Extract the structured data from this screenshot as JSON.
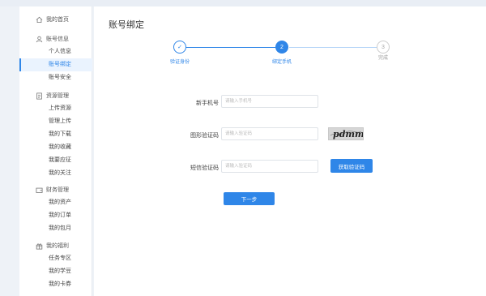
{
  "sidebar": {
    "home": {
      "label": "我的首页",
      "icon": "home-icon"
    },
    "account": {
      "label": "账号信息",
      "icon": "user-icon",
      "items": [
        "个人信息",
        "账号绑定",
        "账号安全"
      ],
      "active_index": 1
    },
    "resources": {
      "label": "资源管理",
      "icon": "document-icon",
      "items": [
        "上传资源",
        "管理上传",
        "我的下载",
        "我的收藏",
        "我要应征",
        "我的关注"
      ]
    },
    "finance": {
      "label": "财务管理",
      "icon": "wallet-icon",
      "items": [
        "我的资产",
        "我的订单",
        "我的包月"
      ]
    },
    "welfare": {
      "label": "我的福利",
      "icon": "gift-icon",
      "items": [
        "任务专区",
        "我的学豆",
        "我的卡券"
      ]
    }
  },
  "main": {
    "title": "账号绑定",
    "steps": [
      {
        "label": "验证身份",
        "mark": "✓",
        "state": "done"
      },
      {
        "label": "绑定手机",
        "mark": "2",
        "state": "current"
      },
      {
        "label": "完成",
        "mark": "3",
        "state": "todo"
      }
    ],
    "form": {
      "phone": {
        "label": "新手机号",
        "placeholder": "请输入手机号"
      },
      "image_code": {
        "label": "图形验证码",
        "placeholder": "请输入验证码",
        "captcha_text": "pdmm"
      },
      "sms_code": {
        "label": "短信验证码",
        "placeholder": "请输入验证码",
        "button": "获取验证码"
      },
      "next_button": "下一步"
    }
  },
  "colors": {
    "accent": "#2f86e8",
    "active_bg": "#eaf3fe",
    "todo": "#cccccc"
  }
}
